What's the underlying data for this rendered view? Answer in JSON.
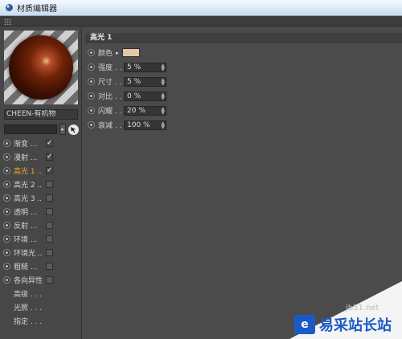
{
  "window": {
    "title": "材质编辑器"
  },
  "material": {
    "name": "CHEEN-有机物"
  },
  "channels": [
    {
      "label": "渐变 ...",
      "checked": true
    },
    {
      "label": "漫射 ...",
      "checked": true
    },
    {
      "label": "高光 1 ..",
      "checked": true,
      "active": true
    },
    {
      "label": "高光 2 ..",
      "checked": false
    },
    {
      "label": "高光 3 ..",
      "checked": false
    },
    {
      "label": "透明 ...",
      "checked": false
    },
    {
      "label": "反射 ...",
      "checked": false
    },
    {
      "label": "环境 ...",
      "checked": false
    },
    {
      "label": "环境光 ..",
      "checked": false
    },
    {
      "label": "粗糙 ...",
      "checked": false
    },
    {
      "label": "各向异性",
      "checked": false
    },
    {
      "label": "高级 . . ."
    },
    {
      "label": "光照 . . ."
    },
    {
      "label": "指定 . . ."
    }
  ],
  "section": {
    "title": "高光 1",
    "color_label": "颜色",
    "color_value": "#e4c7a7",
    "params": [
      {
        "label": "强度 . .",
        "value": "5 %"
      },
      {
        "label": "尺寸 . .",
        "value": "5 %"
      },
      {
        "label": "对比 . .",
        "value": "0 %"
      },
      {
        "label": "闪耀 . .",
        "value": "20 %"
      },
      {
        "label": "衰减 . .",
        "value": "100 %"
      }
    ]
  },
  "watermark": {
    "site": "jb51.net",
    "brand": "易采站长站",
    "badge": "e"
  },
  "icons": {
    "app": "material-icon",
    "picker": "pointer-icon",
    "grip": "grip-icon"
  }
}
